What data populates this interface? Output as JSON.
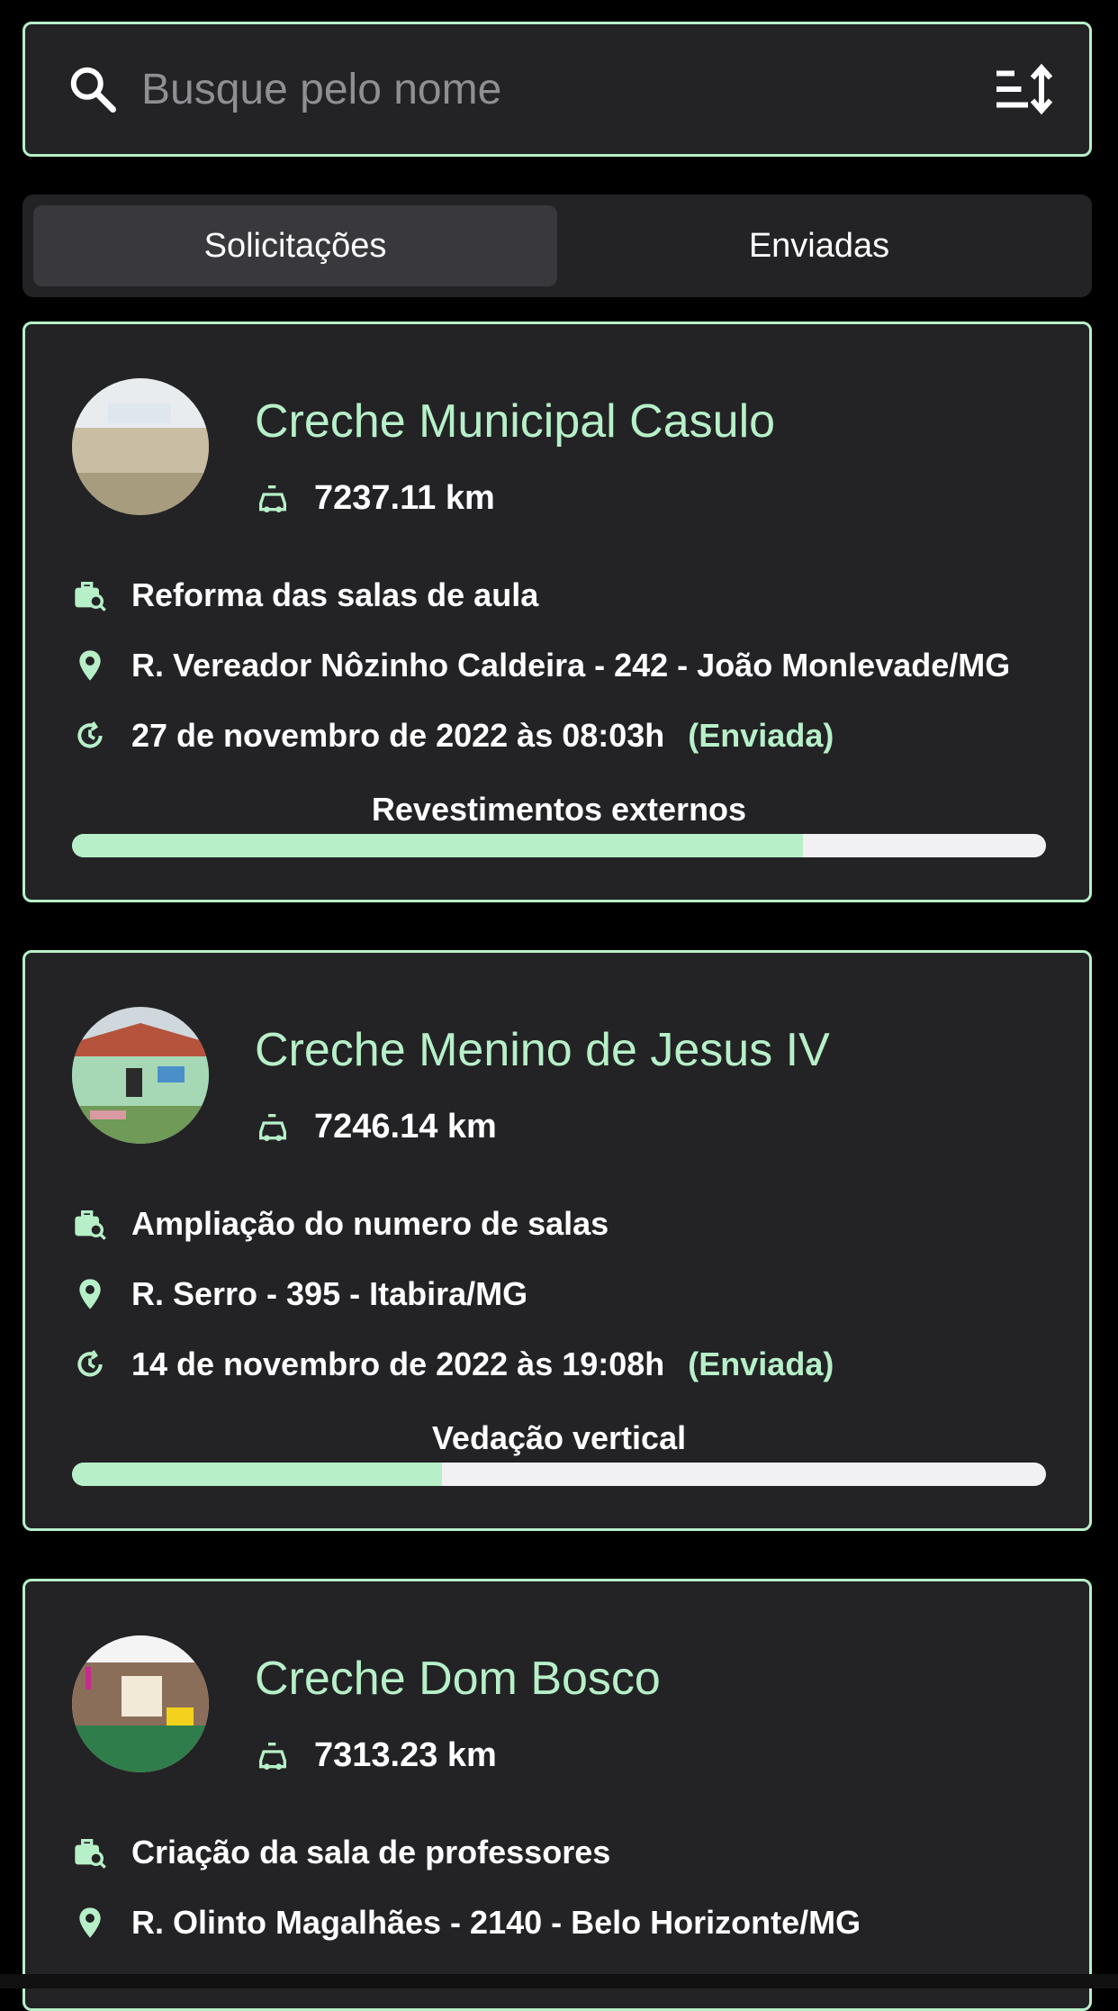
{
  "search": {
    "placeholder": "Busque pelo nome"
  },
  "tabs": [
    {
      "label": "Solicitações",
      "active": true
    },
    {
      "label": "Enviadas",
      "active": false
    }
  ],
  "cards": [
    {
      "name": "Creche Municipal Casulo",
      "distance": "7237.11 km",
      "project": "Reforma das salas de aula",
      "address": "R. Vereador Nôzinho Caldeira - 242 - João Monlevade/MG",
      "date": "27 de novembro de 2022 às 08:03h",
      "status": "(Enviada)",
      "stage": "Revestimentos externos",
      "progress_percent": 75
    },
    {
      "name": "Creche Menino de Jesus IV",
      "distance": "7246.14 km",
      "project": "Ampliação do numero de salas",
      "address": "R. Serro - 395 - Itabira/MG",
      "date": "14 de novembro de 2022 às 19:08h",
      "status": "(Enviada)",
      "stage": "Vedação vertical",
      "progress_percent": 38
    },
    {
      "name": "Creche Dom Bosco",
      "distance": "7313.23 km",
      "project": "Criação da sala de professores",
      "address": "R. Olinto Magalhães - 2140 - Belo Horizonte/MG"
    }
  ],
  "icons": {
    "search": "search-icon",
    "sort": "sort-icon",
    "distance": "car-icon",
    "project": "briefcase-search-icon",
    "address": "map-pin-icon",
    "date": "clock-history-icon"
  },
  "colors": {
    "accent": "#b7f0c8",
    "card_bg": "#232326",
    "background": "#000000"
  }
}
